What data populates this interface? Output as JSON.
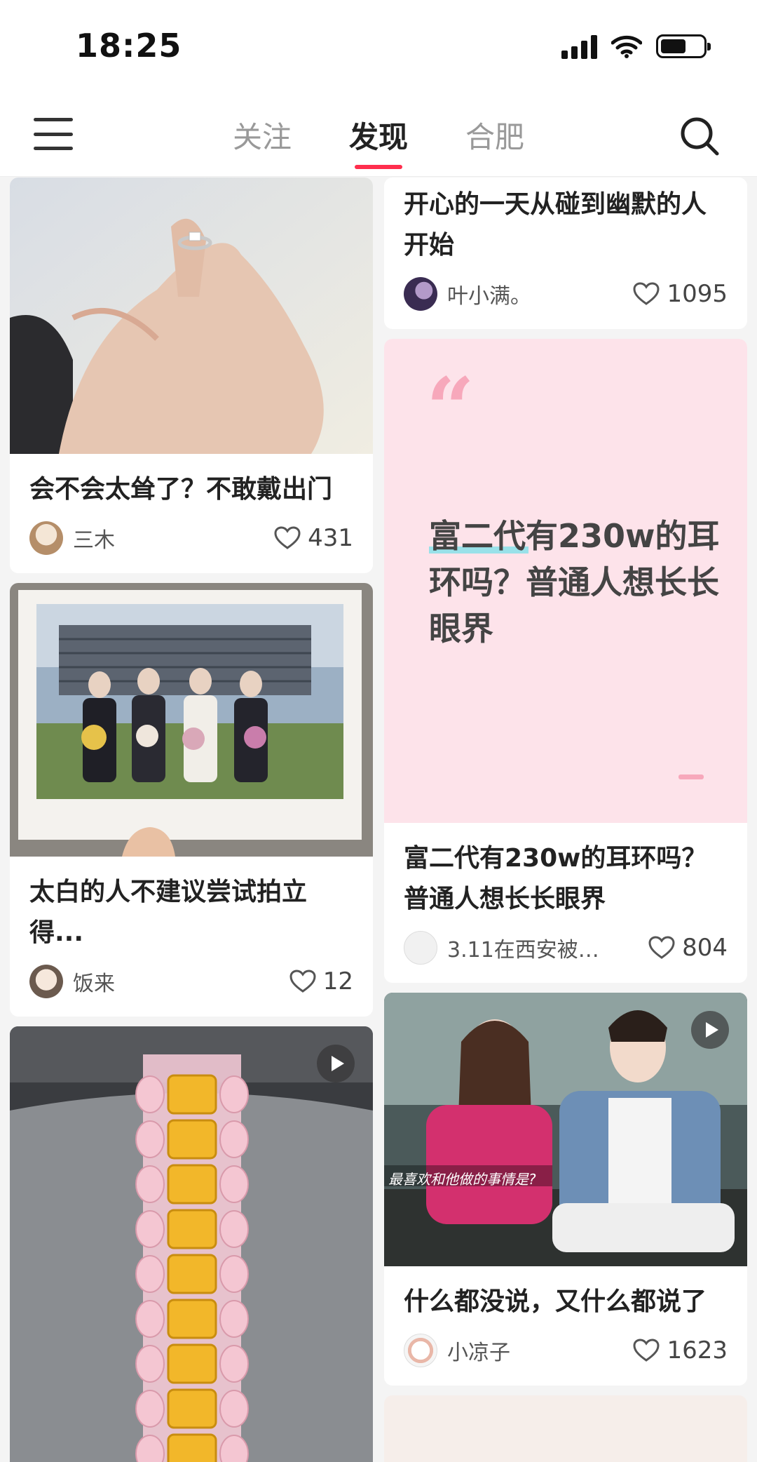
{
  "status_bar": {
    "time": "18:25"
  },
  "nav": {
    "tabs": [
      {
        "label": "关注"
      },
      {
        "label": "发现"
      },
      {
        "label": "合肥"
      }
    ],
    "active_tab": "发现",
    "accent_color": "#ff2e4d"
  },
  "feed": {
    "left": [
      {
        "title": "会不会太耸了？不敢戴出门",
        "author": "三木",
        "likes": "431",
        "image": "ring-on-hand",
        "video": false
      },
      {
        "title": "太白的人不建议尝试拍立得...",
        "author": "饭来",
        "likes": "12",
        "image": "polaroid-graduation-photo",
        "video": false
      },
      {
        "title": "",
        "author": "",
        "likes": "",
        "image": "diamond-bracelet",
        "video": true
      }
    ],
    "right": [
      {
        "title": "开心的一天从碰到幽默的人开始",
        "author": "叶小满。",
        "likes": "1095",
        "image": "",
        "video": false
      },
      {
        "quote": "富二代有230w的耳环吗？普通人想长长眼界",
        "title": "富二代有230w的耳环吗？普通人想长长眼界",
        "author": "3.11在西安被偷...",
        "likes": "804",
        "image": "pink-quote-card",
        "video": false
      },
      {
        "title": "什么都没说，又什么都说了",
        "author": "小凉子",
        "likes": "1623",
        "image": "interview-couple",
        "video": true,
        "caption": "最喜欢和他做的事情是?"
      }
    ]
  },
  "icons": [
    "menu-icon",
    "search-icon",
    "heart-icon",
    "play-icon",
    "signal-icon",
    "wifi-icon",
    "battery-icon"
  ]
}
